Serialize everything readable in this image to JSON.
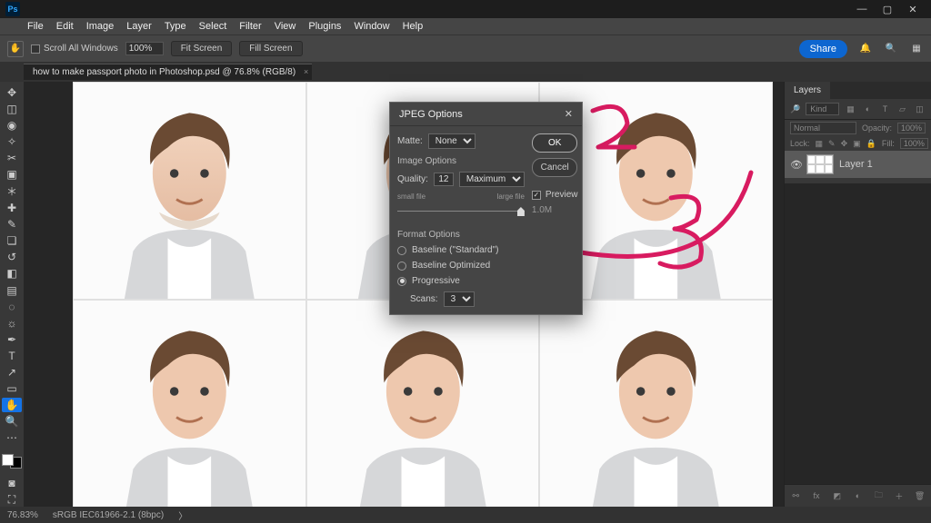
{
  "app": {
    "abbrev": "Ps"
  },
  "menus": [
    "File",
    "Edit",
    "Image",
    "Layer",
    "Type",
    "Select",
    "Filter",
    "View",
    "Plugins",
    "Window",
    "Help"
  ],
  "opts": {
    "scroll_all": "Scroll All Windows",
    "zoom": "100%",
    "fit_screen": "Fit Screen",
    "fill_screen": "Fill Screen",
    "share": "Share"
  },
  "doc": {
    "tab_title": "how to make passport photo in Photoshop.psd @ 76.8% (RGB/8)"
  },
  "panel": {
    "tabs": [
      "Layers"
    ],
    "filter_kind": "Kind",
    "blend": "Normal",
    "opacity_label": "Opacity:",
    "opacity_value": "100%",
    "lock_label": "Lock:",
    "fill_label": "Fill:",
    "fill_value": "100%",
    "layer1": "Layer 1"
  },
  "status": {
    "zoom": "76.83%",
    "profile": "sRGB IEC61966-2.1 (8bpc)"
  },
  "dialog": {
    "title": "JPEG Options",
    "matte_label": "Matte:",
    "matte_value": "None",
    "image_options": "Image Options",
    "quality_label": "Quality:",
    "quality_value": "12",
    "quality_preset": "Maximum",
    "slider_small": "small file",
    "slider_large": "large file",
    "format_options": "Format Options",
    "radio_standard": "Baseline (\"Standard\")",
    "radio_optimized": "Baseline Optimized",
    "radio_progressive": "Progressive",
    "scans_label": "Scans:",
    "scans_value": "3",
    "ok": "OK",
    "cancel": "Cancel",
    "preview": "Preview",
    "filesize": "1.0M"
  },
  "annotation": {
    "color": "#d81b60"
  }
}
